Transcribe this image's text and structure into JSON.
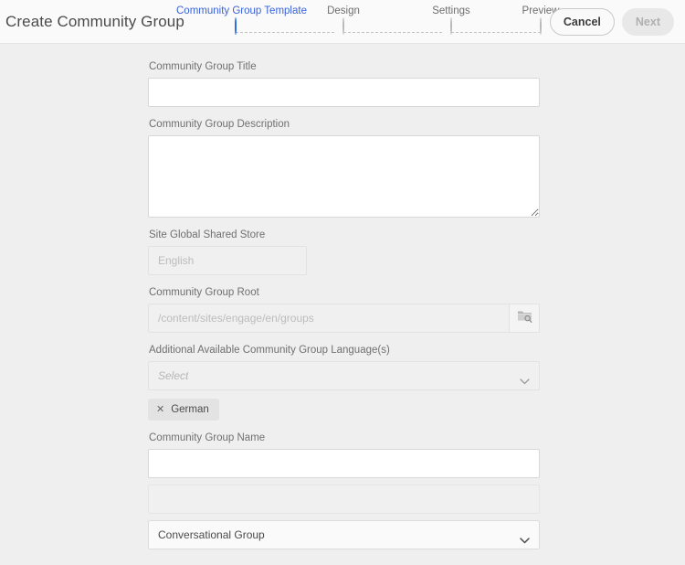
{
  "header": {
    "title": "Create Community Group",
    "cancel_label": "Cancel",
    "next_label": "Next",
    "accent_color": "#2f6ee0",
    "active_step_text_color": "#3b63d8",
    "steps": [
      {
        "label": "Community Group Template",
        "state": "active"
      },
      {
        "label": "Design",
        "state": "inactive"
      },
      {
        "label": "Settings",
        "state": "inactive"
      },
      {
        "label": "Preview",
        "state": "inactive"
      }
    ]
  },
  "form": {
    "title_field": {
      "label": "Community Group Title",
      "value": "",
      "placeholder": ""
    },
    "description_field": {
      "label": "Community Group Description",
      "value": "",
      "placeholder": ""
    },
    "shared_store_field": {
      "label": "Site Global Shared Store",
      "value": "",
      "placeholder": "English"
    },
    "group_root_field": {
      "label": "Community Group Root",
      "value": "",
      "placeholder": "/content/sites/engage/en/groups",
      "browse_icon": "folder-search-icon"
    },
    "languages_field": {
      "label": "Additional Available Community Group Language(s)",
      "placeholder": "Select",
      "chevron_icon": "chevron-down-icon",
      "chips": [
        {
          "label": "German",
          "remove_icon": "close-icon"
        }
      ]
    },
    "group_name_field": {
      "label": "Community Group Name",
      "value": "",
      "placeholder": ""
    },
    "group_type_select": {
      "value": "Conversational Group",
      "chevron_icon": "chevron-down-icon"
    }
  }
}
